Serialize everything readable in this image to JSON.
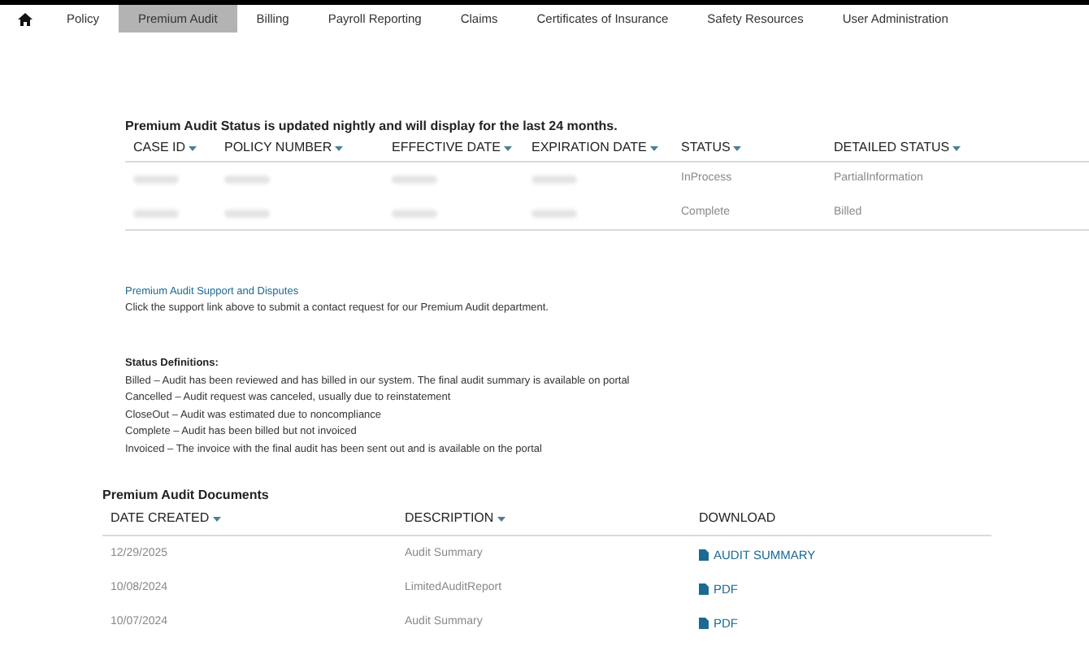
{
  "nav": {
    "tabs": [
      {
        "label": "Policy",
        "selected": false
      },
      {
        "label": "Premium Audit",
        "selected": true
      },
      {
        "label": "Billing",
        "selected": false
      },
      {
        "label": "Payroll Reporting",
        "selected": false
      },
      {
        "label": "Claims",
        "selected": false
      },
      {
        "label": "Certificates of Insurance",
        "selected": false
      },
      {
        "label": "Safety Resources",
        "selected": false
      },
      {
        "label": "User Administration",
        "selected": false
      }
    ]
  },
  "status_section": {
    "heading": "Premium Audit Status is updated nightly and will display for the last 24 months.",
    "columns": [
      {
        "label": "CASE ID",
        "sortable": true
      },
      {
        "label": "POLICY NUMBER",
        "sortable": true
      },
      {
        "label": "EFFECTIVE DATE",
        "sortable": true
      },
      {
        "label": "EXPIRATION DATE",
        "sortable": true
      },
      {
        "label": "STATUS",
        "sortable": true
      },
      {
        "label": "DETAILED STATUS",
        "sortable": true
      }
    ],
    "rows": [
      [
        {
          "redacted": true
        },
        {
          "redacted": true
        },
        {
          "redacted": true
        },
        {
          "redacted": true
        },
        {
          "redacted": false,
          "text": "InProcess"
        },
        {
          "redacted": false,
          "text": "PartialInformation"
        }
      ],
      [
        {
          "redacted": true
        },
        {
          "redacted": true
        },
        {
          "redacted": true
        },
        {
          "redacted": true
        },
        {
          "redacted": false,
          "text": "Complete"
        },
        {
          "redacted": false,
          "text": "Billed"
        }
      ]
    ]
  },
  "support": {
    "link": "Premium Audit Support and Disputes",
    "note": "Click the support link above to submit a contact request for our Premium Audit department."
  },
  "definitions": {
    "heading": "Status Definitions:",
    "lines": [
      "Billed – Audit has been reviewed and has billed in our system. The final audit summary is available on portal",
      "Cancelled – Audit request was canceled, usually due to reinstatement",
      "CloseOut – Audit was estimated due to noncompliance",
      "Complete – Audit has been billed but not invoiced",
      "Invoiced – The invoice with the final audit has been sent out and is available on the portal"
    ]
  },
  "documents": {
    "heading": "Premium Audit Documents",
    "columns": [
      {
        "label": "DATE CREATED",
        "sortable": true
      },
      {
        "label": "DESCRIPTION",
        "sortable": true
      },
      {
        "label": "DOWNLOAD",
        "sortable": false
      }
    ],
    "rows": [
      {
        "date": "12/29/2025",
        "description": "Audit Summary",
        "download": "AUDIT SUMMARY"
      },
      {
        "date": "10/08/2024",
        "description": "LimitedAuditReport",
        "download": "PDF"
      },
      {
        "date": "10/07/2024",
        "description": "Audit Summary",
        "download": "PDF"
      }
    ]
  }
}
